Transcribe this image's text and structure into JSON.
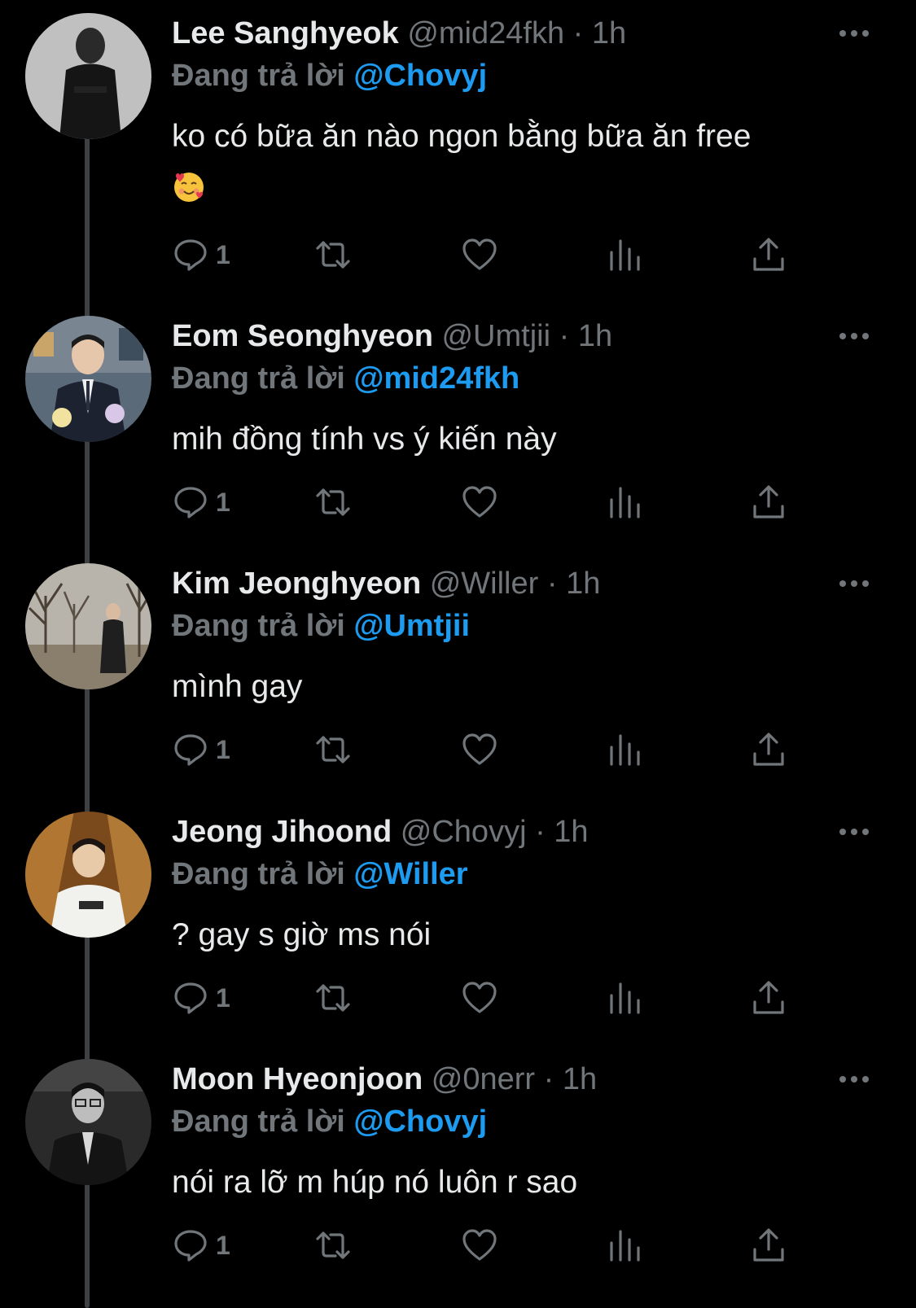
{
  "reply_prefix": "Đang trả lời",
  "colors": {
    "background": "#000000",
    "mention": "#1d9bf0",
    "muted": "#71767b",
    "text": "#e7e9ea"
  },
  "tweets": [
    {
      "display_name": "Lee Sanghyeok",
      "handle": "@mid24fkh",
      "time": "1h",
      "reply_to": "@Chovyj",
      "text": "ko có bữa ăn nào ngon bằng bữa ăn free",
      "emoji": "smiling-face-with-hearts-icon",
      "reply_count": "1"
    },
    {
      "display_name": "Eom Seonghyeon",
      "handle": "@Umtjii",
      "time": "1h",
      "reply_to": "@mid24fkh",
      "text": "mih đồng tính vs ý kiến này",
      "reply_count": "1"
    },
    {
      "display_name": "Kim Jeonghyeon",
      "handle": "@Willer",
      "time": "1h",
      "reply_to": "@Umtjii",
      "text": "mình gay",
      "reply_count": "1"
    },
    {
      "display_name": "Jeong Jihoond",
      "handle": "@Chovyj",
      "time": "1h",
      "reply_to": "@Willer",
      "text": "? gay s giờ ms nói",
      "reply_count": "1"
    },
    {
      "display_name": "Moon Hyeonjoon",
      "handle": "@0nerr",
      "time": "1h",
      "reply_to": "@Chovyj",
      "text": "nói ra lỡ m húp nó luôn r sao",
      "reply_count": "1"
    }
  ]
}
